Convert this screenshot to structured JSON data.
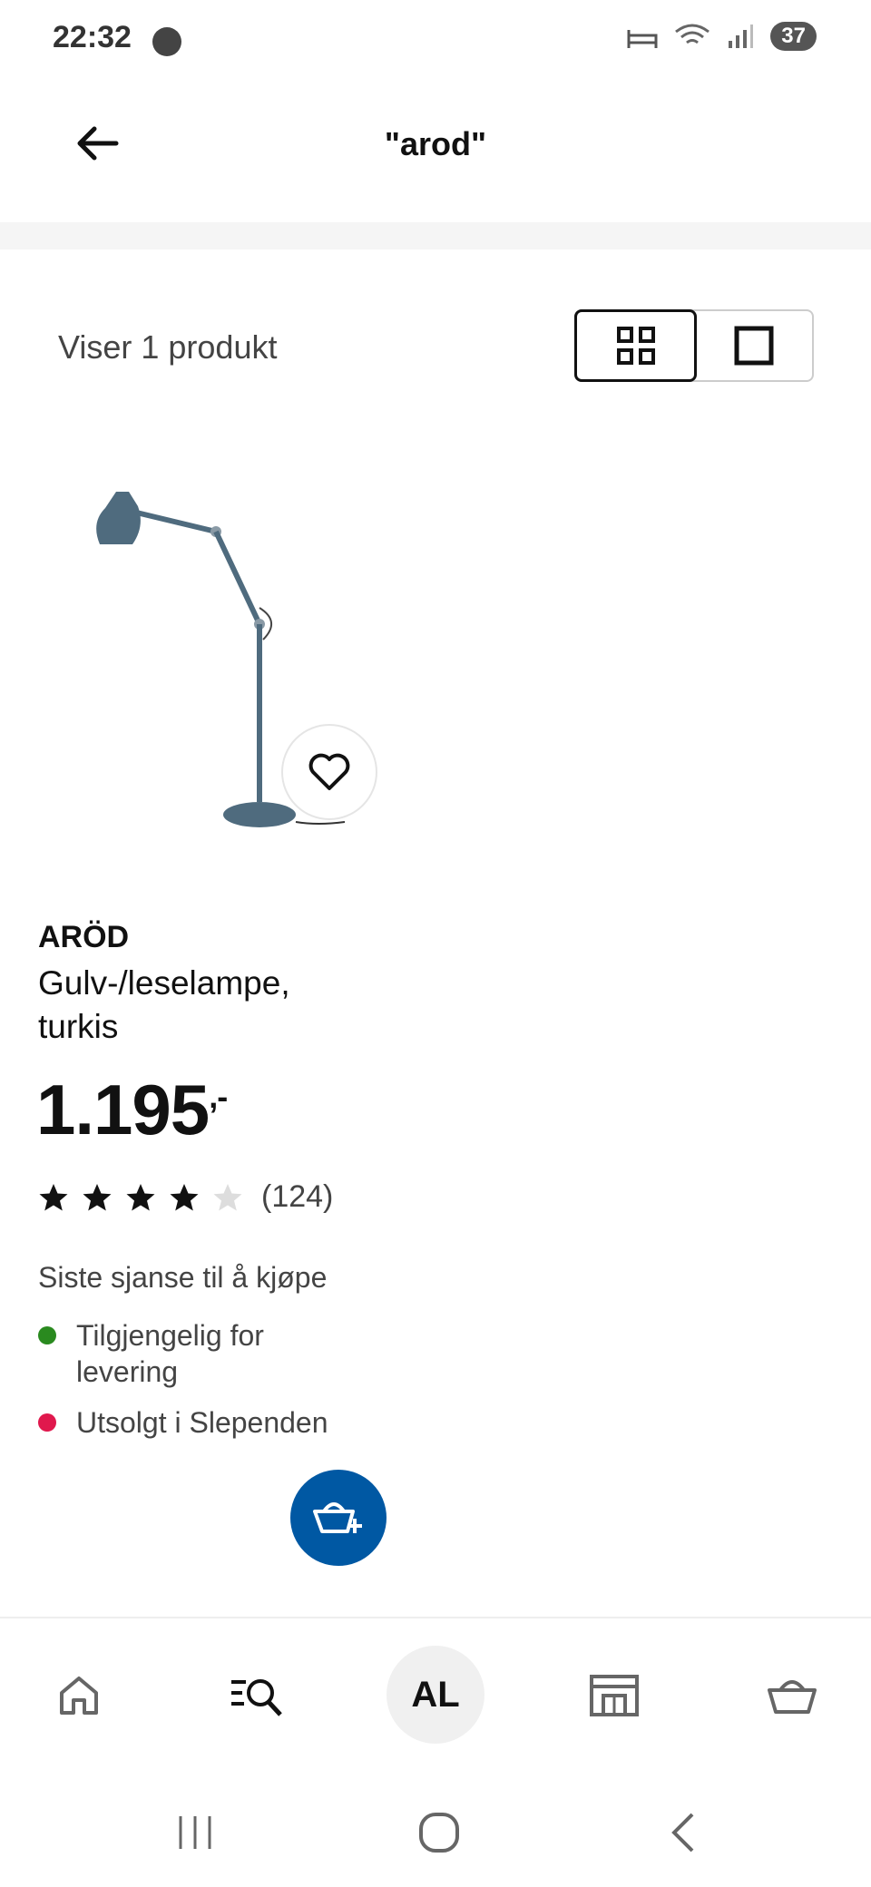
{
  "status_bar": {
    "time": "22:32",
    "battery": "37"
  },
  "header": {
    "title": "\"arod\""
  },
  "results": {
    "count_text": "Viser 1 produkt"
  },
  "product": {
    "name": "ARÖD",
    "description": "Gulv-/leselampe, turkis",
    "price": "1.195",
    "price_suffix": ",-",
    "rating": 4,
    "rating_max": 5,
    "review_count": "(124)",
    "last_chance": "Siste sjanse til å kjøpe",
    "availability": [
      {
        "text": "Tilgjengelig for levering",
        "color": "#2a8a1f"
      },
      {
        "text": "Utsolgt i Slependen",
        "color": "#e0184d"
      }
    ]
  },
  "bottom_nav": {
    "avatar_initials": "AL"
  },
  "colors": {
    "accent": "#0058a3"
  }
}
